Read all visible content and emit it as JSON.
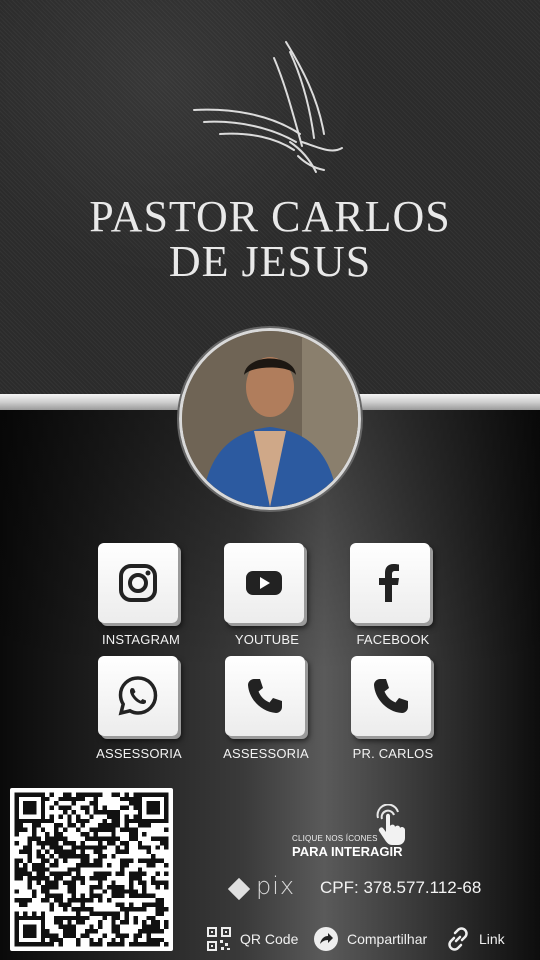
{
  "header": {
    "title_line1": "PASTOR CARLOS",
    "title_line2": "DE JESUS"
  },
  "profile": {
    "avatar_icon": "person-photo-icon"
  },
  "links": [
    {
      "label": "INSTAGRAM",
      "icon": "instagram-icon"
    },
    {
      "label": "YOUTUBE",
      "icon": "youtube-icon"
    },
    {
      "label": "FACEBOOK",
      "icon": "facebook-icon"
    },
    {
      "label": "ASSESSORIA",
      "icon": "whatsapp-icon"
    },
    {
      "label": "ASSESSORIA",
      "icon": "phone-icon"
    },
    {
      "label": "PR. CARLOS",
      "icon": "phone-icon"
    }
  ],
  "hint": {
    "line1": "CLIQUE NOS ÍCONES",
    "line2": "PARA INTERAGIR",
    "icon": "tap-hand-icon"
  },
  "payment": {
    "brand": "pix",
    "cpf": "CPF: 378.577.112-68"
  },
  "actions": [
    {
      "label": "QR Code",
      "icon": "qr-code-icon"
    },
    {
      "label": "Compartilhar",
      "icon": "share-icon"
    },
    {
      "label": "Link",
      "icon": "link-icon"
    }
  ],
  "colors": {
    "tile_bg": "#ffffff",
    "icon_dark": "#222222",
    "text": "#ffffff"
  }
}
